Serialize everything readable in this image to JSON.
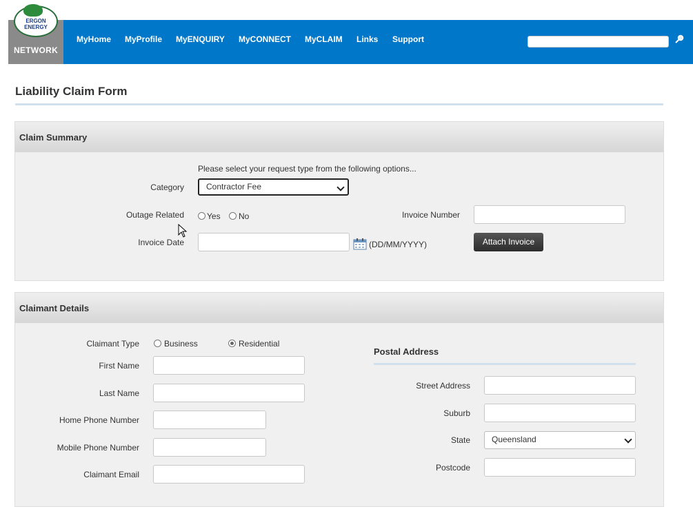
{
  "header": {
    "logo_text": "ERGON ENERGY",
    "logo_network": "NETWORK",
    "nav": [
      "MyHome",
      "MyProfile",
      "MyENQUIRY",
      "MyCONNECT",
      "MyCLAIM",
      "Links",
      "Support"
    ],
    "search_placeholder": "",
    "brand_color": "#0077c8"
  },
  "page": {
    "title": "Liability Claim Form"
  },
  "claim_summary": {
    "title": "Claim Summary",
    "instruction": "Please select your request type from the following options...",
    "category_label": "Category",
    "category_value": "Contractor Fee",
    "outage_label": "Outage Related",
    "outage_yes": "Yes",
    "outage_no": "No",
    "invoice_date_label": "Invoice Date",
    "date_hint": "(DD/MM/YYYY)",
    "invoice_number_label": "Invoice Number",
    "attach_button": "Attach Invoice"
  },
  "claimant": {
    "title": "Claimant Details",
    "type_label": "Claimant Type",
    "type_business": "Business",
    "type_residential": "Residential",
    "selected_type": "Residential",
    "first_name": "First Name",
    "last_name": "Last Name",
    "home_phone": "Home Phone Number",
    "mobile_phone": "Mobile Phone Number",
    "email": "Claimant Email",
    "postal": {
      "title": "Postal Address",
      "street": "Street Address",
      "suburb": "Suburb",
      "state_label": "State",
      "state_value": "Queensland",
      "postcode": "Postcode"
    }
  }
}
